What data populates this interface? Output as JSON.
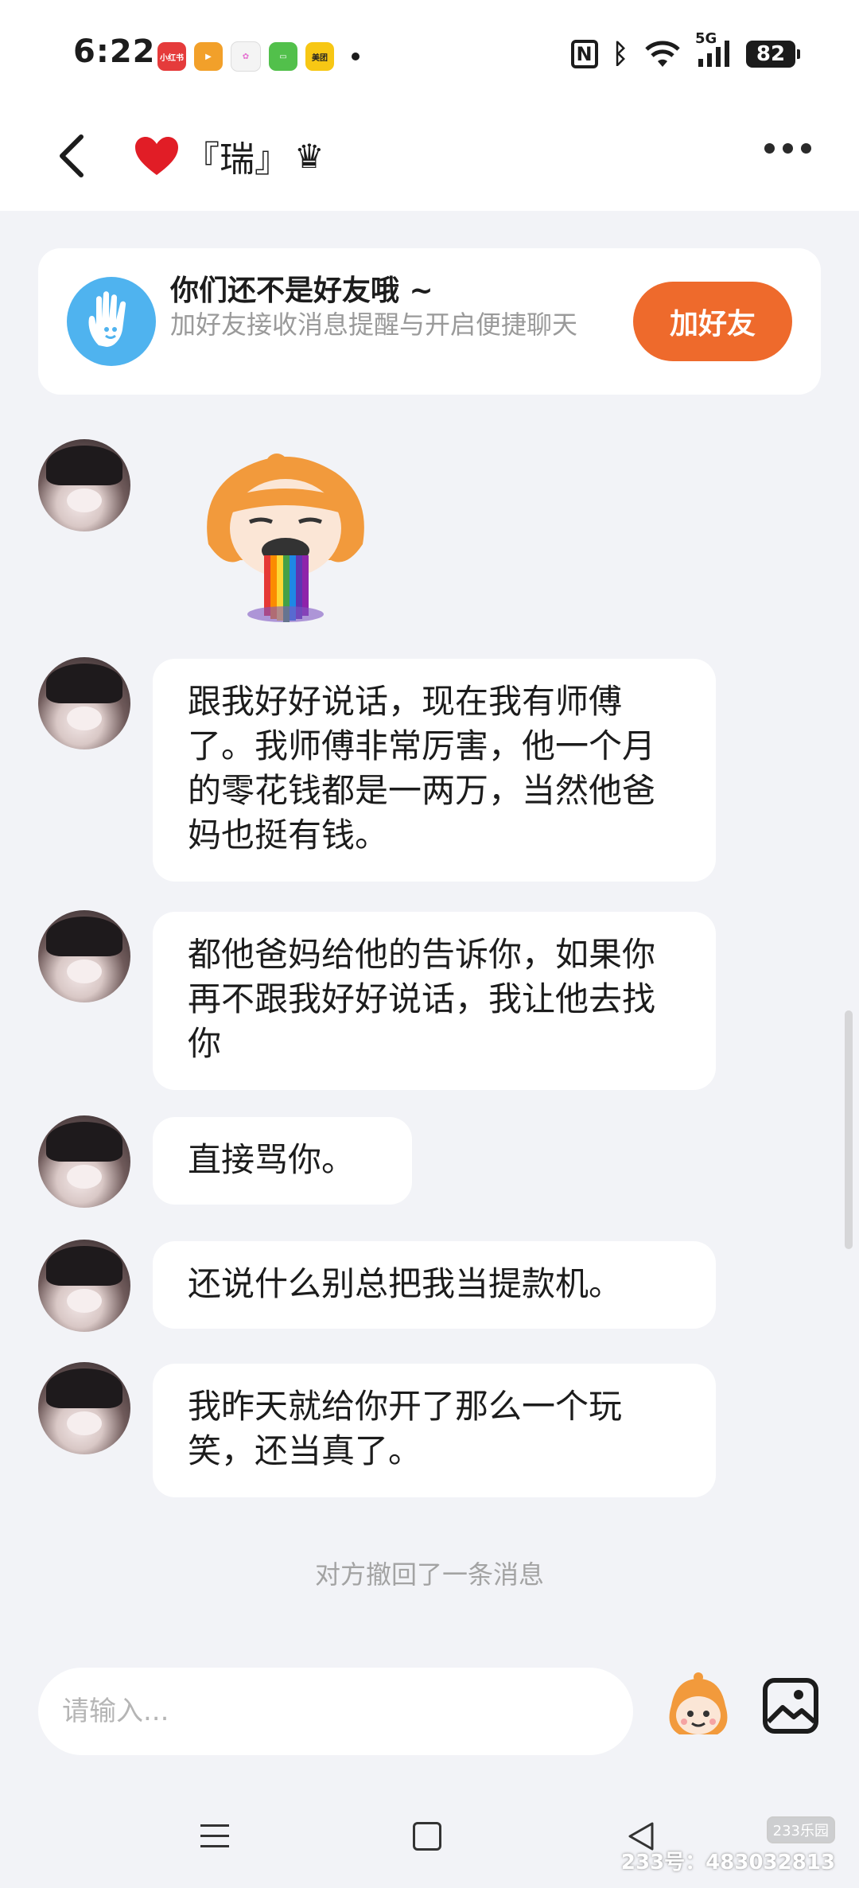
{
  "status_bar": {
    "time": "6:22",
    "app_icons": [
      {
        "name": "xiaohongshu",
        "label": "小红书",
        "color": "#e53b3b"
      },
      {
        "name": "video",
        "label": "",
        "color": "#f2a02a"
      },
      {
        "name": "gallery",
        "label": "",
        "color": "#e46fd0"
      },
      {
        "name": "message",
        "label": "",
        "color": "#52c04b"
      },
      {
        "name": "meituan",
        "label": "美团",
        "color": "#f7c714"
      }
    ],
    "network": "5G",
    "battery": "82"
  },
  "header": {
    "contact_name": "『瑞』",
    "name_prefix_icon": "red-heart",
    "name_suffix_icon": "crown"
  },
  "friend_notice": {
    "title": "你们还不是好友哦 ~",
    "subtitle": "加好友接收消息提醒与开启便捷聊天",
    "button": "加好友"
  },
  "messages": [
    {
      "type": "sticker",
      "sticker": "rainbow-vomit-character"
    },
    {
      "type": "text",
      "text": "跟我好好说话，现在我有师傅了。我师傅非常厉害，他一个月的零花钱都是一两万，当然他爸妈也挺有钱。"
    },
    {
      "type": "text",
      "text": "都他爸妈给他的告诉你，如果你再不跟我好好说话，我让他去找你"
    },
    {
      "type": "text",
      "text": "直接骂你。"
    },
    {
      "type": "text",
      "text": "还说什么别总把我当提款机。"
    },
    {
      "type": "text",
      "text": "我昨天就给你开了那么一个玩笑，还当真了。"
    }
  ],
  "recall_notice": "对方撤回了一条消息",
  "input": {
    "placeholder": "请输入..."
  },
  "watermark": {
    "logo": "233乐园",
    "text": "233号：483032813"
  }
}
